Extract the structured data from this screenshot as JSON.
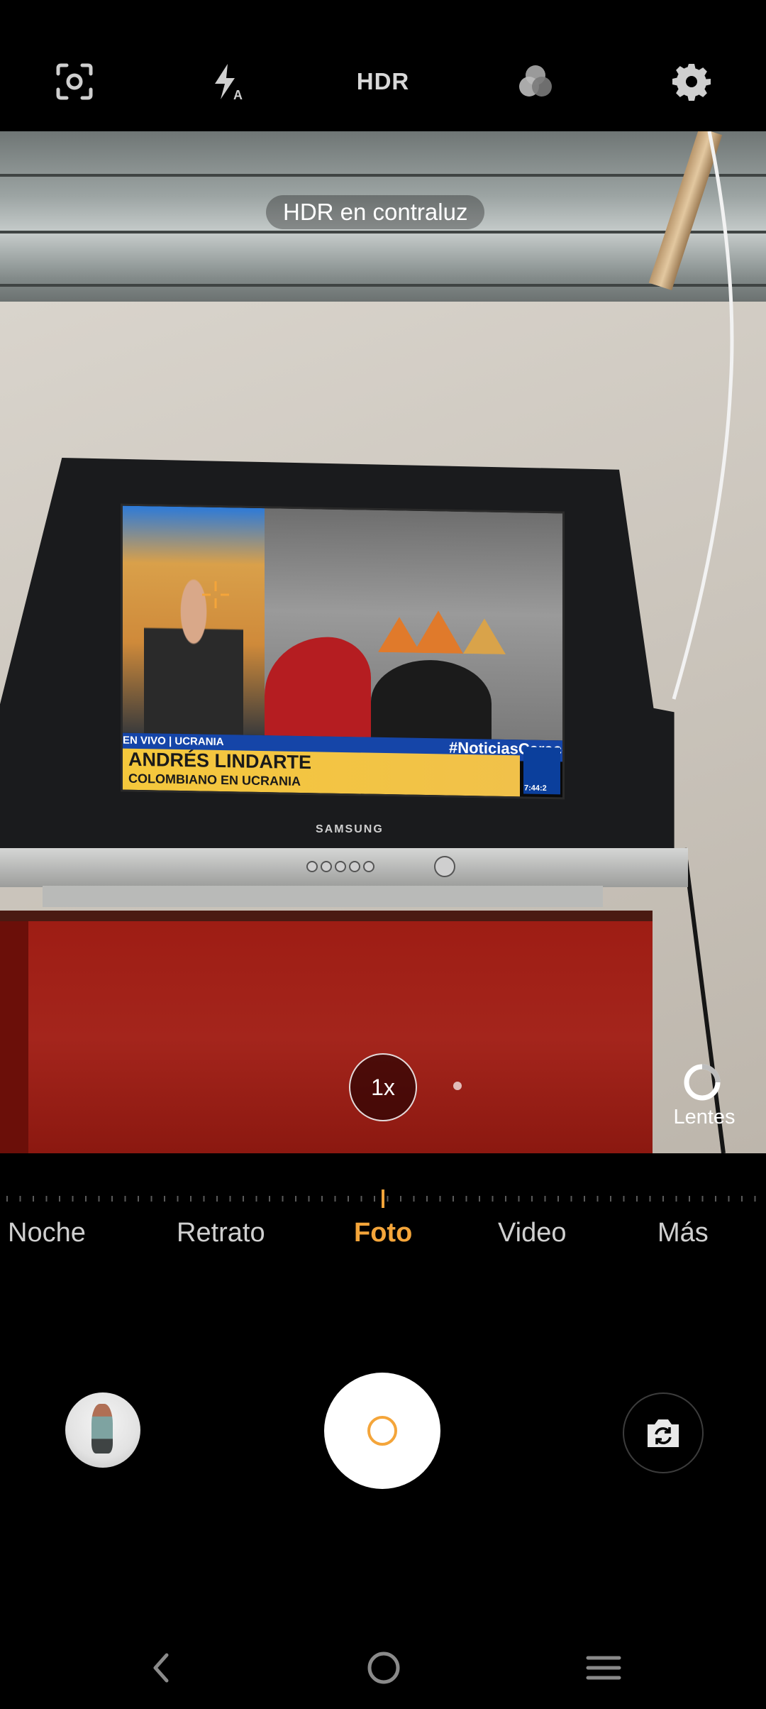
{
  "top_bar": {
    "icons": [
      "focus-frame-icon",
      "flash-auto-icon",
      "hdr",
      "filters-icon",
      "settings-gear-icon"
    ],
    "hdr_label": "HDR"
  },
  "viewfinder": {
    "hdr_hint": "HDR en contraluz",
    "tv_brand": "SAMSUNG",
    "tv_screen": {
      "live_tag": "EN VIVO | UCRANIA",
      "hashtag": "#NoticiasCaracol",
      "name": "ANDRÉS LINDARTE",
      "subtitle": "COLOMBIANO EN UCRANIA",
      "time": "7:44:2"
    },
    "zoom_label": "1x",
    "lens_label": "Lentes"
  },
  "modes": {
    "items": [
      {
        "label": "Noche",
        "active": false
      },
      {
        "label": "Retrato",
        "active": false
      },
      {
        "label": "Foto",
        "active": true
      },
      {
        "label": "Video",
        "active": false
      },
      {
        "label": "Más",
        "active": false
      }
    ]
  },
  "controls": {
    "gallery_icon": "gallery-thumbnail",
    "shutter_icon": "shutter-button",
    "flip_icon": "switch-camera-icon"
  },
  "nav": {
    "icons": [
      "back-icon",
      "home-icon",
      "recents-icon"
    ]
  },
  "colors": {
    "accent": "#f4a53a",
    "background": "#000000",
    "inactive_text": "#cfcfcf"
  }
}
